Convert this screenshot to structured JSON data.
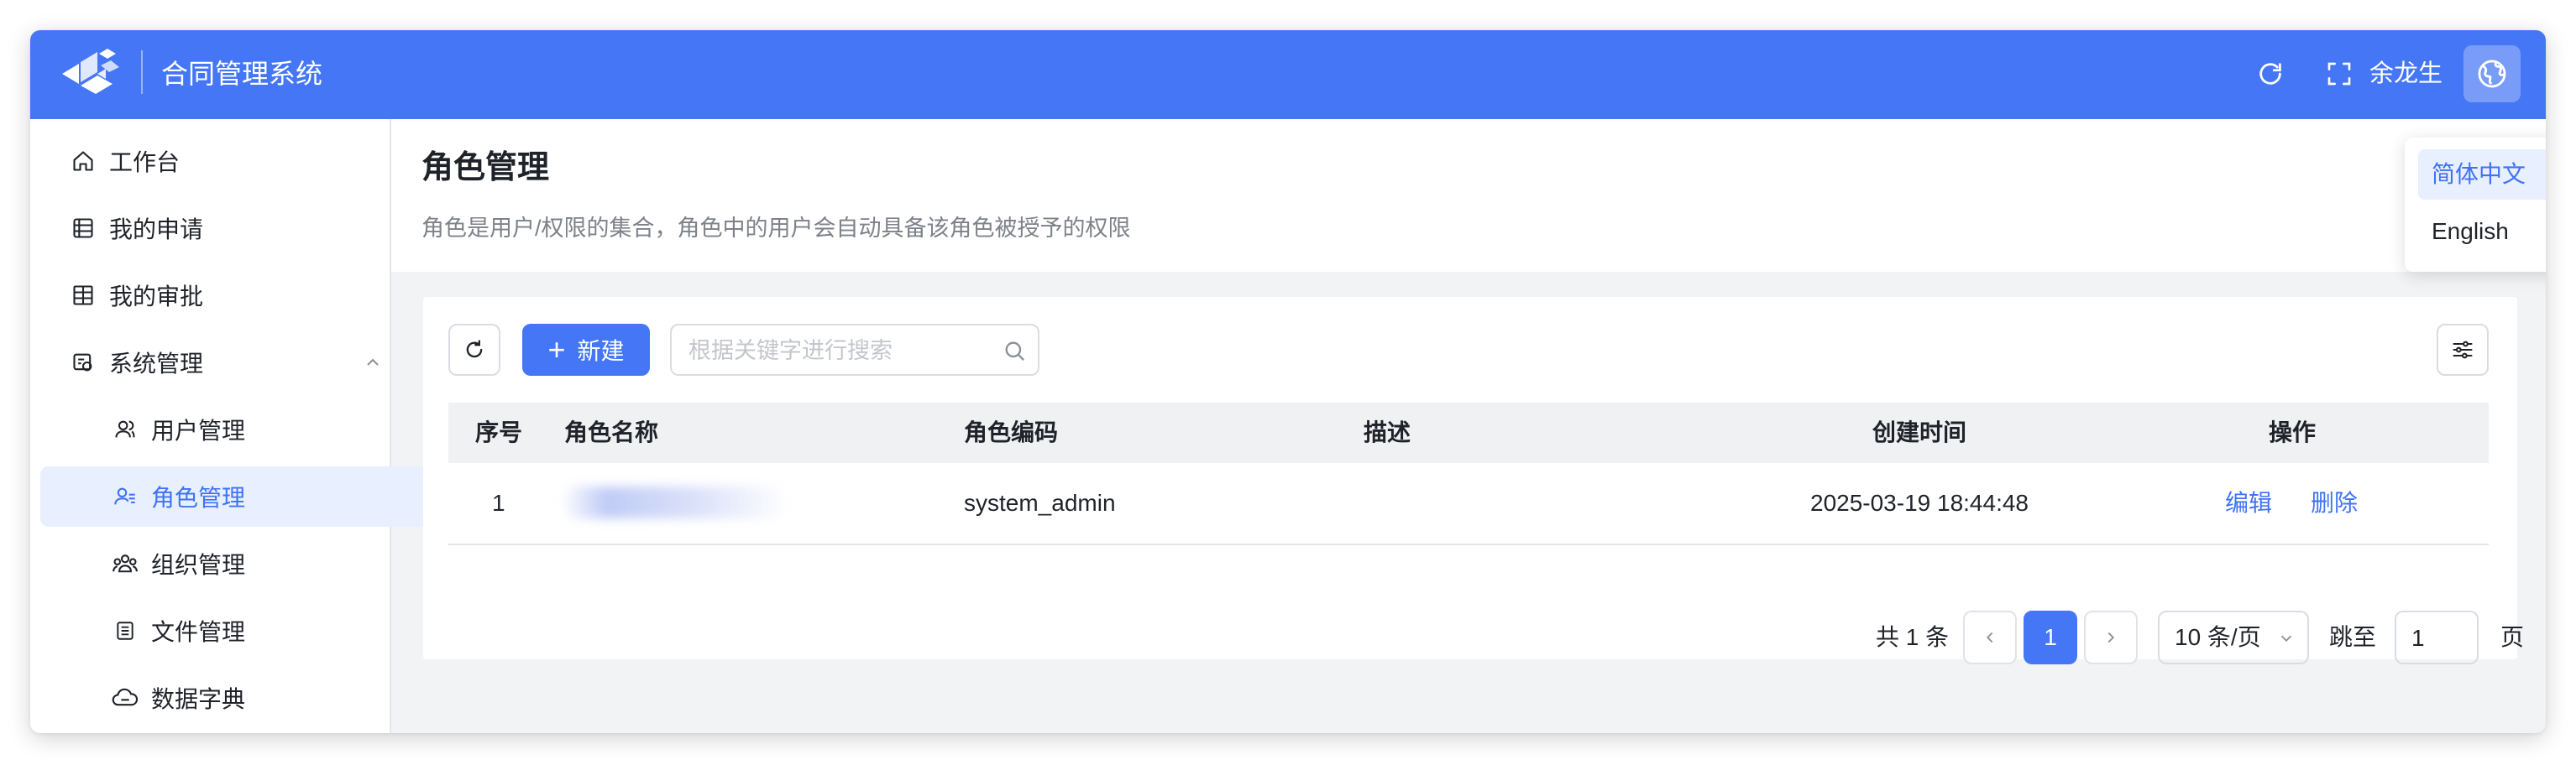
{
  "header": {
    "app_title": "合同管理系统",
    "user_name": "余龙生",
    "icons": [
      "refresh-icon",
      "fullscreen-icon",
      "globe-icon"
    ]
  },
  "language_menu": {
    "options": [
      {
        "label": "简体中文",
        "selected": true
      },
      {
        "label": "English",
        "selected": false
      }
    ]
  },
  "sidebar": {
    "items": [
      {
        "label": "工作台",
        "icon": "home-icon"
      },
      {
        "label": "我的申请",
        "icon": "list-icon"
      },
      {
        "label": "我的审批",
        "icon": "approval-icon"
      },
      {
        "label": "系统管理",
        "icon": "settings-icon",
        "expanded": true
      },
      {
        "label": "用户管理",
        "icon": "user-icon"
      },
      {
        "label": "角色管理",
        "icon": "role-icon",
        "active": true
      },
      {
        "label": "组织管理",
        "icon": "org-icon"
      },
      {
        "label": "文件管理",
        "icon": "file-icon"
      },
      {
        "label": "数据字典",
        "icon": "cloud-icon"
      }
    ]
  },
  "page": {
    "title": "角色管理",
    "description": "角色是用户/权限的集合，角色中的用户会自动具备该角色被授予的权限"
  },
  "toolbar": {
    "new_label": "新建",
    "search_placeholder": "根据关键字进行搜索"
  },
  "table": {
    "columns": [
      "序号",
      "角色名称",
      "角色编码",
      "描述",
      "创建时间",
      "操作"
    ],
    "rows": [
      {
        "index": "1",
        "name": "",
        "code": "system_admin",
        "description": "",
        "created_at": "2025-03-19 18:44:48",
        "actions": [
          "编辑",
          "删除"
        ]
      }
    ]
  },
  "pagination": {
    "total_text": "共 1 条",
    "current_page": "1",
    "page_size": "10 条/页",
    "jump_label": "跳至",
    "jump_value": "1",
    "page_suffix": "页"
  },
  "colors": {
    "primary": "#4476f5",
    "link": "#3f72f5",
    "active_bg": "#e8effe"
  }
}
